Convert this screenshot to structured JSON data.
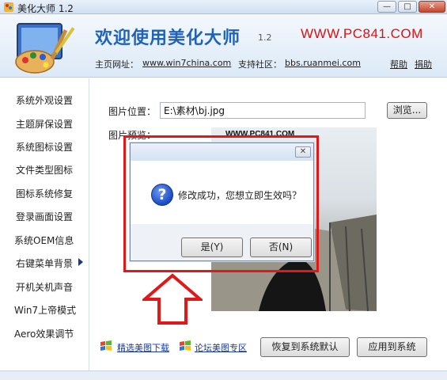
{
  "window": {
    "title": "美化大师 1.2",
    "min_label": "—",
    "max_label": "□",
    "close_label": "✕"
  },
  "header": {
    "welcome": "欢迎使用美化大师",
    "version": "1.2",
    "brand": "WWW.PC841.COM",
    "homepage_label": "主页网址：",
    "homepage_link": "www.win7china.com",
    "community_label": "支持社区：",
    "community_link": "bbs.ruanmei.com",
    "help_link": "帮助",
    "donate_link": "捐助"
  },
  "sidebar": {
    "items": [
      {
        "label": "系统外观设置"
      },
      {
        "label": "主题屏保设置"
      },
      {
        "label": "系统图标设置"
      },
      {
        "label": "文件类型图标"
      },
      {
        "label": "图标系统修复"
      },
      {
        "label": "登录画面设置"
      },
      {
        "label": "系统OEM信息"
      },
      {
        "label": "右键菜单背景"
      },
      {
        "label": "开机关机声音"
      },
      {
        "label": "Win7上帝模式"
      },
      {
        "label": "Aero效果调节"
      }
    ]
  },
  "content": {
    "image_location_label": "图片位置：",
    "image_path_value": "E:\\素材\\bj.jpg",
    "browse_button": "浏览...",
    "preview_label": "图片预览：",
    "preview_watermark": "WWW.PC841.COM",
    "restore_button": "恢复到系统默认",
    "apply_button": "应用到系统",
    "footer_link_1": "精选美图下载",
    "footer_link_2": "论坛美图专区"
  },
  "dialog": {
    "close_label": "✕",
    "icon": "question-icon",
    "message": "修改成功，您想立即生效吗？",
    "yes_button": "是(Y)",
    "no_button": "否(N)"
  },
  "colors": {
    "accent": "#1f62b8",
    "brand_red": "#e01010",
    "highlight_red": "#e01818"
  }
}
